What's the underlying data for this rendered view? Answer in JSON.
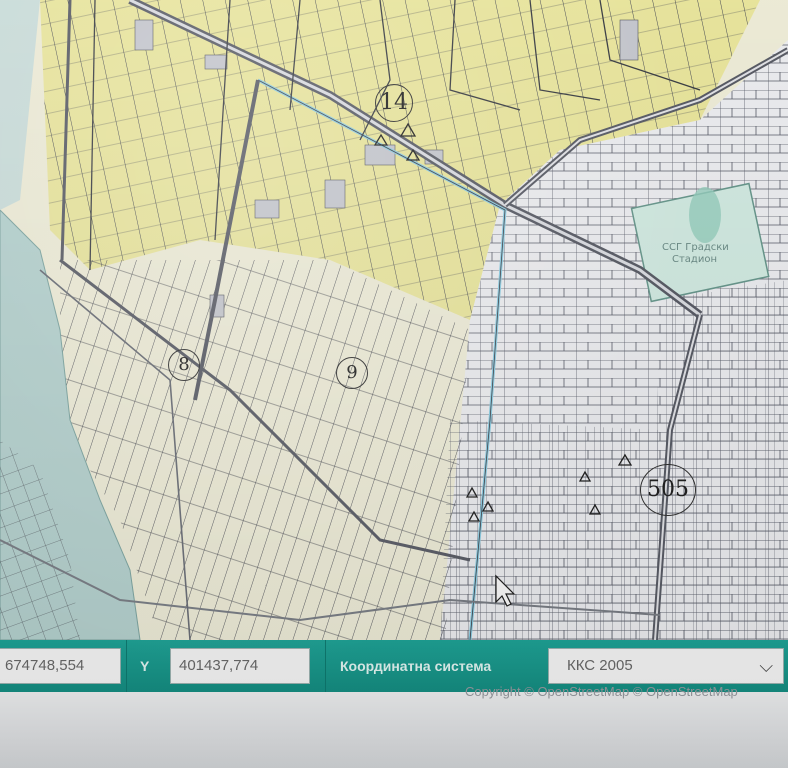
{
  "map": {
    "labels": [
      "14",
      "8",
      "9",
      "505"
    ],
    "colors": {
      "zone_yellow": "#eeeaa0",
      "zone_pale": "#f3f1dc",
      "zone_white": "#f1f2f5",
      "river": "#b9d6d3",
      "parcel_line": "#4a4d55",
      "road": "#5b5e68",
      "canal": "#8fd2e8",
      "stadium": "#d6efe6"
    },
    "icons": [
      "monument-triangle-icon",
      "cursor-arrow-icon"
    ],
    "stadium_label": "ССГ Градски Стадион"
  },
  "coordbar": {
    "x_value": "674748,554",
    "y_label": "Y",
    "y_value": "401437,774",
    "system_label": "Координатна система",
    "system_value": "ККС 2005",
    "accent": "#1aa194"
  },
  "attribution": "Copyright © OpenStreetMap © OpenStreetMap"
}
